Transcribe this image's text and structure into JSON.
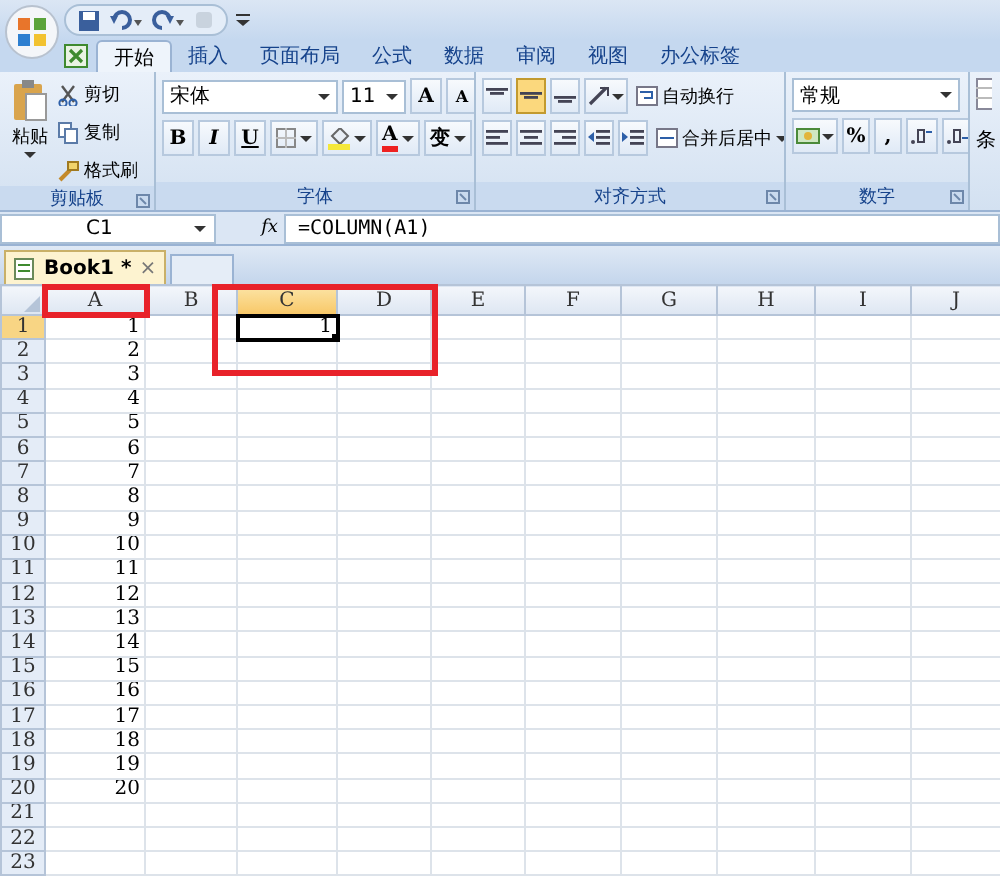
{
  "tabs": [
    {
      "label": "开始",
      "selected": true
    },
    {
      "label": "插入",
      "selected": false
    },
    {
      "label": "页面布局",
      "selected": false
    },
    {
      "label": "公式",
      "selected": false
    },
    {
      "label": "数据",
      "selected": false
    },
    {
      "label": "审阅",
      "selected": false
    },
    {
      "label": "视图",
      "selected": false
    },
    {
      "label": "办公标签",
      "selected": false
    }
  ],
  "clipboard": {
    "label": "剪贴板",
    "paste": "粘贴",
    "cut": "剪切",
    "copy": "复制",
    "format_painter": "格式刷"
  },
  "font": {
    "label": "字体",
    "font_name": "宋体",
    "font_size": "11",
    "grow": "A",
    "shrink": "A",
    "bold": "B",
    "italic": "I",
    "underline": "U",
    "font_color": "A",
    "phonetic": "变"
  },
  "alignment": {
    "label": "对齐方式",
    "vertical_align": [
      {
        "selected": false
      },
      {
        "selected": true
      },
      {
        "selected": false
      }
    ],
    "wrap_text": "自动换行",
    "merge_center": "合并后居中"
  },
  "number": {
    "label": "数字",
    "format": "常规",
    "percent": "%",
    "comma": ","
  },
  "group_5": {
    "label": "条"
  },
  "name_box": "C1",
  "fx": "fx",
  "formula": "=COLUMN(A1)",
  "workbook_tabs": [
    {
      "label": "Book1 *",
      "close": "×",
      "selected": true
    }
  ],
  "sheet": {
    "selection_outlined": true,
    "columns": [
      {
        "label": "A",
        "selected": false,
        "outlined": true
      },
      {
        "label": "B",
        "selected": false,
        "outlined": false
      },
      {
        "label": "C",
        "selected": true,
        "outlined": false
      },
      {
        "label": "D",
        "selected": false,
        "outlined": false
      },
      {
        "label": "E",
        "selected": false,
        "outlined": false
      },
      {
        "label": "F",
        "selected": false,
        "outlined": false
      },
      {
        "label": "G",
        "selected": false,
        "outlined": false
      },
      {
        "label": "H",
        "selected": false,
        "outlined": false
      },
      {
        "label": "I",
        "selected": false,
        "outlined": false
      },
      {
        "label": "J",
        "selected": false,
        "outlined": false
      }
    ],
    "rows": [
      {
        "label": "1",
        "selected": true,
        "cells": [
          "1",
          "",
          "1"
        ]
      },
      {
        "label": "2",
        "selected": false,
        "cells": [
          "2"
        ]
      },
      {
        "label": "3",
        "selected": false,
        "cells": [
          "3"
        ]
      },
      {
        "label": "4",
        "selected": false,
        "cells": [
          "4"
        ]
      },
      {
        "label": "5",
        "selected": false,
        "cells": [
          "5"
        ]
      },
      {
        "label": "6",
        "selected": false,
        "cells": [
          "6"
        ]
      },
      {
        "label": "7",
        "selected": false,
        "cells": [
          "7"
        ]
      },
      {
        "label": "8",
        "selected": false,
        "cells": [
          "8"
        ]
      },
      {
        "label": "9",
        "selected": false,
        "cells": [
          "9"
        ]
      },
      {
        "label": "10",
        "selected": false,
        "cells": [
          "10"
        ]
      },
      {
        "label": "11",
        "selected": false,
        "cells": [
          "11"
        ]
      },
      {
        "label": "12",
        "selected": false,
        "cells": [
          "12"
        ]
      },
      {
        "label": "13",
        "selected": false,
        "cells": [
          "13"
        ]
      },
      {
        "label": "14",
        "selected": false,
        "cells": [
          "14"
        ]
      },
      {
        "label": "15",
        "selected": false,
        "cells": [
          "15"
        ]
      },
      {
        "label": "16",
        "selected": false,
        "cells": [
          "16"
        ]
      },
      {
        "label": "17",
        "selected": false,
        "cells": [
          "17"
        ]
      },
      {
        "label": "18",
        "selected": false,
        "cells": [
          "18"
        ]
      },
      {
        "label": "19",
        "selected": false,
        "cells": [
          "19"
        ]
      },
      {
        "label": "20",
        "selected": false,
        "cells": [
          "20"
        ]
      },
      {
        "label": "21",
        "selected": false
      },
      {
        "label": "22",
        "selected": false
      },
      {
        "label": "23",
        "selected": false
      }
    ]
  }
}
